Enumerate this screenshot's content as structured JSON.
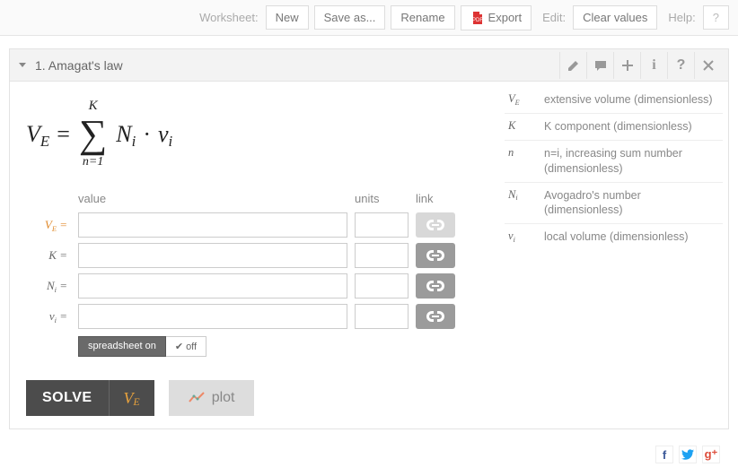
{
  "toolbar": {
    "worksheet_label": "Worksheet:",
    "new": "New",
    "save_as": "Save as...",
    "rename": "Rename",
    "export": "Export",
    "edit_label": "Edit:",
    "clear_values": "Clear values",
    "help_label": "Help:",
    "help_q": "?"
  },
  "card": {
    "title": "1. Amagat's law"
  },
  "formula": {
    "lhs_var": "V",
    "lhs_sub": "E",
    "eq": "=",
    "sum_upper": "K",
    "sum_lower": "n=1",
    "term1_var": "N",
    "term1_sub": "i",
    "dot": "·",
    "term2_var": "v",
    "term2_sub": "i"
  },
  "defs": [
    {
      "sym": "V",
      "sub": "E",
      "desc": "extensive volume (dimensionless)"
    },
    {
      "sym": "K",
      "sub": "",
      "desc": "K component (dimensionless)"
    },
    {
      "sym": "n",
      "sub": "",
      "desc": "n=i, increasing sum number (dimensionless)"
    },
    {
      "sym": "N",
      "sub": "i",
      "desc": "Avogadro's number (dimensionless)"
    },
    {
      "sym": "v",
      "sub": "i",
      "desc": "local volume (dimensionless)"
    }
  ],
  "grid": {
    "hd_value": "value",
    "hd_units": "units",
    "hd_link": "link",
    "rows": [
      {
        "var": "V",
        "sub": "E",
        "active": true,
        "link_disabled": true,
        "value": "",
        "units": ""
      },
      {
        "var": "K",
        "sub": "",
        "active": false,
        "link_disabled": false,
        "value": "",
        "units": ""
      },
      {
        "var": "N",
        "sub": "i",
        "active": false,
        "link_disabled": false,
        "value": "",
        "units": ""
      },
      {
        "var": "v",
        "sub": "i",
        "active": false,
        "link_disabled": false,
        "value": "",
        "units": ""
      }
    ]
  },
  "toggle": {
    "on": "spreadsheet on",
    "off": "off"
  },
  "actions": {
    "solve": "SOLVE",
    "solve_var": "V",
    "solve_sub": "E",
    "plot": "plot"
  }
}
